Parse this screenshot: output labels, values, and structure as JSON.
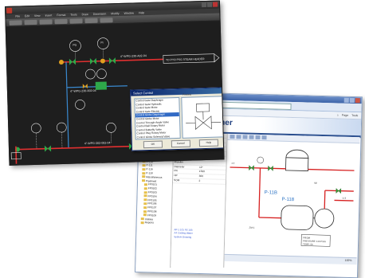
{
  "cad": {
    "menu": [
      "File",
      "Edit",
      "View",
      "Insert",
      "Format",
      "Tools",
      "Draw",
      "Dimension",
      "Modify",
      "Window",
      "Help"
    ],
    "lines": [
      "4\"-WPG-230-A02-04",
      "4\"-WPG-230-002-04",
      "4\"-WPG-202-002-04"
    ],
    "destinations": [
      "TO PYO PSG STEAM HEADER",
      "TO PPO PSG STEAM HEADER"
    ],
    "tags": [
      "PG\n103",
      "FC\n103",
      "AT\n103",
      "PI\n157",
      "PV\n110",
      "AT\n212",
      "FE\n103",
      "BT\n103",
      "BT\n104",
      "PG\n104"
    ],
    "dialog": {
      "title": "Select Control",
      "preview_label": "Preview",
      "items": [
        "Control Gate Diaphragm",
        "Control Gate Hydraulic",
        "Control Gate Motor",
        "Control Gate Electric",
        "Control Globe Diaphragm",
        "Control Globe Motor",
        "Control Through-Angle Valve",
        "Control Ball Rotary Motor",
        "Control Butterfly Valve",
        "Control Plug Rotary Motor",
        "Control Globe Solenoid Valve",
        "Control Plug Solenoid Valve"
      ],
      "selected_index": 4,
      "ok": "OK",
      "cancel": "Cancel",
      "help": "Help"
    }
  },
  "web": {
    "page_title": "ernet Publisher",
    "tools": [
      "⌂",
      "Page",
      "Tools"
    ],
    "tree": [
      "Centrifugal",
      "Controls",
      "Mechanical",
      "P-101",
      "P-102",
      "P-103",
      "P-104",
      "P-110",
      "P-111",
      "P-116",
      "P-118",
      "Miscellaneous",
      "Pipelined",
      "FP0101",
      "FP0102",
      "FP0103",
      "FP0104",
      "FP0105",
      "FP0106",
      "FP0107",
      "PP0108",
      "FP0109",
      "Utilities",
      "Reports"
    ],
    "props": [
      [
        "Service",
        "Circ"
      ],
      [
        "Area",
        "circuit rev Pr"
      ],
      [
        "Description",
        "Pump"
      ],
      [
        "Capacity",
        "100 GPM"
      ],
      [
        "Discharge",
        "3/4"
      ],
      [
        "Pressure",
        "(total)"
      ],
      [
        "Impeller",
        ""
      ],
      [
        "Diameter",
        "12\""
      ],
      [
        "PR",
        "1500"
      ],
      [
        "HP",
        "300"
      ],
      [
        "SOM",
        "2"
      ]
    ],
    "links": [
      "AP-1 101 FE 103",
      "A4 Cooling Water",
      "System Drawing"
    ],
    "tags": [
      "FT",
      "P-118",
      "P-11B",
      "SE",
      "V-3",
      "ZM-1",
      "FC",
      "PV",
      "FI"
    ],
    "drawing_labels": [
      "FROM",
      "SAVE SPECIAL",
      "ATMOS. SUPPLY",
      "PRESSURE: 110 PSIG",
      "TEMP: 60"
    ],
    "status_zoom": "100%"
  }
}
